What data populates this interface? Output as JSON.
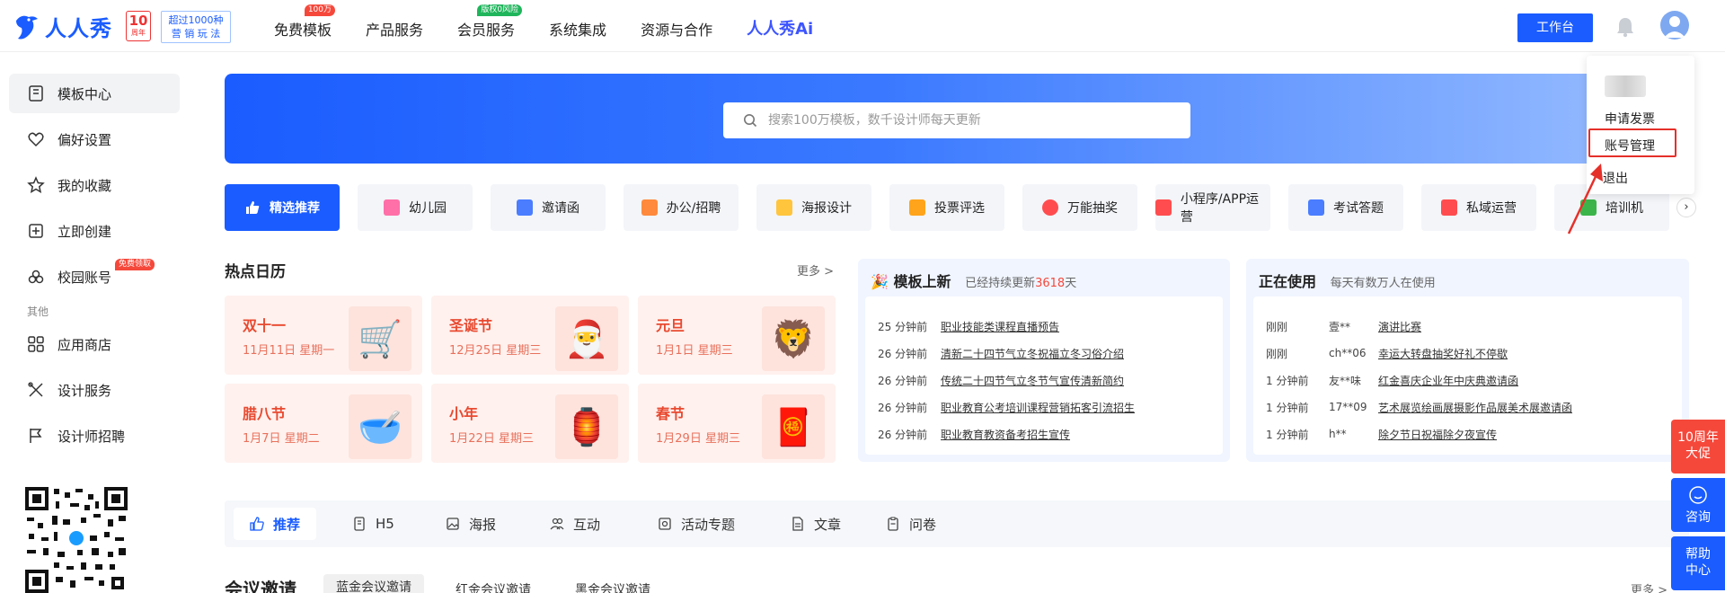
{
  "header": {
    "logo_text": "人人秀",
    "anniv_num": "10",
    "anniv_label": "周年",
    "promo_line1": "超过1000种",
    "promo_line2": "营 销 玩 法",
    "nav": [
      {
        "label": "免费模板",
        "tag": "100万"
      },
      {
        "label": "产品服务",
        "tag": ""
      },
      {
        "label": "会员服务",
        "tag": "版权0风险"
      },
      {
        "label": "系统集成",
        "tag": ""
      },
      {
        "label": "资源与合作",
        "tag": ""
      }
    ],
    "nav_ai": "人人秀Ai",
    "workbench_label": "工作台"
  },
  "sidebar": {
    "items": [
      {
        "label": "模板中心"
      },
      {
        "label": "偏好设置"
      },
      {
        "label": "我的收藏"
      },
      {
        "label": "立即创建"
      },
      {
        "label": "校园账号",
        "tag": "免费领取"
      }
    ],
    "section": "其他",
    "others": [
      {
        "label": "应用商店"
      },
      {
        "label": "设计服务"
      },
      {
        "label": "设计师招聘"
      }
    ]
  },
  "search": {
    "placeholder": "搜索100万模板，数千设计师每天更新"
  },
  "categories": [
    {
      "label": "精选推荐",
      "color": "#ffffff"
    },
    {
      "label": "幼儿园",
      "color": "#ff6fa8"
    },
    {
      "label": "邀请函",
      "color": "#4a7dff"
    },
    {
      "label": "办公/招聘",
      "color": "#ff8a3d"
    },
    {
      "label": "海报设计",
      "color": "#ffc53d"
    },
    {
      "label": "投票评选",
      "color": "#ffa41b"
    },
    {
      "label": "万能抽奖",
      "color": "#ff4d4f"
    },
    {
      "label": "小程序/APP运营",
      "color": "#ff4d4f"
    },
    {
      "label": "考试答题",
      "color": "#4a7dff"
    },
    {
      "label": "私域运营",
      "color": "#ff4d4f"
    },
    {
      "label": "培训机",
      "color": "#3bb54a"
    }
  ],
  "calendar": {
    "title": "热点日历",
    "more": "更多 >",
    "items": [
      {
        "name": "双十一",
        "date": "11月11日  星期一",
        "emoji": "🛒"
      },
      {
        "name": "圣诞节",
        "date": "12月25日  星期三",
        "emoji": "🎅"
      },
      {
        "name": "元旦",
        "date": "1月1日  星期三",
        "emoji": "🦁"
      },
      {
        "name": "腊八节",
        "date": "1月7日  星期二",
        "emoji": "🥣"
      },
      {
        "name": "小年",
        "date": "1月22日  星期三",
        "emoji": "🏮"
      },
      {
        "name": "春节",
        "date": "1月29日  星期三",
        "emoji": "🧧"
      }
    ]
  },
  "new_templates": {
    "title": "模板上新",
    "sub_prefix": "已经持续更新",
    "sub_days": "3618",
    "sub_suffix": "天",
    "rows": [
      {
        "time": "25 分钟前",
        "title": "职业技能类课程直播预告"
      },
      {
        "time": "26 分钟前",
        "title": "清新二十四节气立冬祝福立冬习俗介绍"
      },
      {
        "time": "26 分钟前",
        "title": "传统二十四节气立冬节气宣传清新简约"
      },
      {
        "time": "26 分钟前",
        "title": "职业教育公考培训课程营销拓客引流招生"
      },
      {
        "time": "26 分钟前",
        "title": "职业教育教资备考招生宣传"
      }
    ]
  },
  "in_use": {
    "title": "正在使用",
    "sub": "每天有数万人在使用",
    "rows": [
      {
        "time": "刚刚",
        "user": "壹**",
        "title": "演讲比赛"
      },
      {
        "time": "刚刚",
        "user": "ch**06",
        "title": "幸运大转盘抽奖好礼不停歇"
      },
      {
        "time": "1 分钟前",
        "user": "友**味",
        "title": "红金喜庆企业年中庆典邀请函"
      },
      {
        "time": "1 分钟前",
        "user": "17**09",
        "title": "艺术展览绘画展摄影作品展美术展邀请函"
      },
      {
        "time": "1 分钟前",
        "user": "h**",
        "title": "除夕节日祝福除夕夜宣传"
      }
    ]
  },
  "tabs": [
    {
      "label": "推荐"
    },
    {
      "label": "H5"
    },
    {
      "label": "海报"
    },
    {
      "label": "互动"
    },
    {
      "label": "活动专题"
    },
    {
      "label": "文章"
    },
    {
      "label": "问卷"
    }
  ],
  "conference": {
    "title": "会议邀请",
    "tabs": [
      "蓝金会议邀请",
      "红金会议邀请",
      "黑金会议邀请"
    ],
    "more": "更多 >"
  },
  "dropdown": {
    "items": [
      "申请发票",
      "账号管理",
      "退出"
    ]
  },
  "float": {
    "promo": [
      "10周年",
      "大促"
    ],
    "consult": "咨询",
    "help": [
      "帮助",
      "中心"
    ]
  },
  "colors": {
    "brand": "#1a5cff",
    "accent_red": "#f5483b",
    "highlight_box": "#e5302a"
  }
}
